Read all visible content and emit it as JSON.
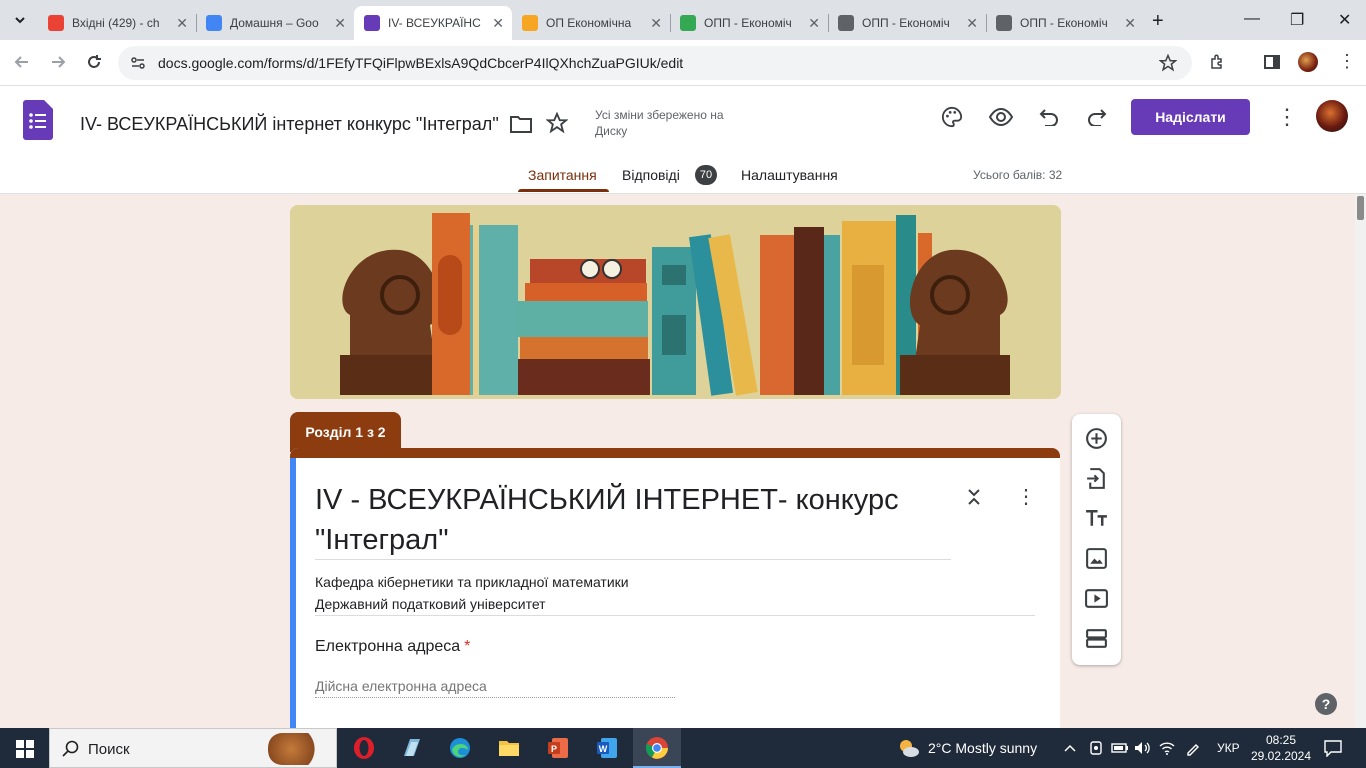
{
  "browser": {
    "tabs": [
      {
        "title": "Вхідні (429) - ch",
        "icon": "gmail-icon",
        "color": "#ea4335"
      },
      {
        "title": "Домашня – Goo",
        "icon": "google-sites-icon",
        "color": "#4285f4"
      },
      {
        "title": "IV- ВСЕУКРАЇНС",
        "icon": "google-forms-icon",
        "color": "#673ab7"
      },
      {
        "title": "ОП Економічна",
        "icon": "moodle-icon",
        "color": "#f6a623"
      },
      {
        "title": "ОПП - Економіч",
        "icon": "google-drive-icon",
        "color": "#34a853"
      },
      {
        "title": "ОПП - Економіч",
        "icon": "globe-icon",
        "color": "#5f6368"
      },
      {
        "title": "ОПП - Економіч",
        "icon": "globe-icon",
        "color": "#5f6368"
      }
    ],
    "url": "docs.google.com/forms/d/1FEfyTFQiFlpwBExlsA9QdCbcerP4IlQXhchZuaPGIUk/edit"
  },
  "forms": {
    "doc_title": "IV- ВСЕУКРАЇНСЬКИЙ інтернет конкурс \"Інтеграл\"",
    "saved_status": "Усі зміни збережено на Диску",
    "send_label": "Надіслати",
    "tabs": {
      "questions": "Запитання",
      "responses": "Відповіді",
      "responses_count": "70",
      "settings": "Налаштування"
    },
    "total_points": "Усього балів: 32",
    "accent": "#8d3c10",
    "brand": "#673ab7"
  },
  "section": {
    "label": "Розділ 1 з 2"
  },
  "form": {
    "title": "IV - ВСЕУКРАЇНСЬКИЙ ІНТЕРНЕТ- конкурс \"Інтеграл\"",
    "description_line1": "Кафедра кібернетики та прикладної математики",
    "description_line2": "Державний податковий університет",
    "email_label": "Електронна адреса",
    "email_required": "*",
    "email_placeholder": "Дійсна електронна адреса"
  },
  "taskbar": {
    "search_placeholder": "Поиск",
    "weather": "2°C  Mostly sunny",
    "lang": "УКР",
    "time": "08:25",
    "date": "29.02.2024"
  }
}
